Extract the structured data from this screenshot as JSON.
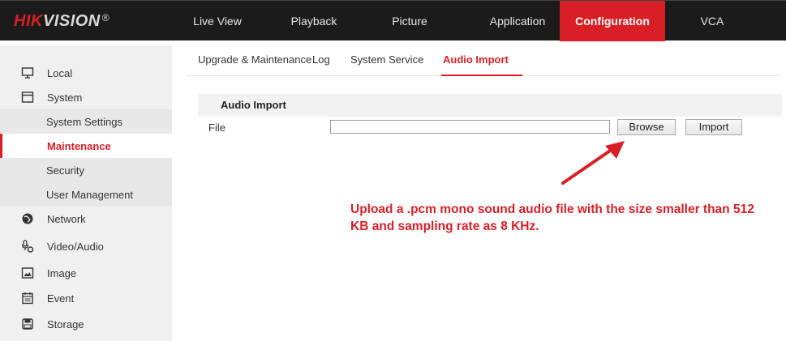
{
  "brand": {
    "prefix": "HIK",
    "suffix": "VISION",
    "reg": "®"
  },
  "topnav": {
    "items": [
      {
        "label": "Live View"
      },
      {
        "label": "Playback"
      },
      {
        "label": "Picture"
      },
      {
        "label": "Application"
      },
      {
        "label": "Configuration",
        "active": true
      },
      {
        "label": "VCA"
      }
    ]
  },
  "sidebar": {
    "items": [
      {
        "label": "Local",
        "icon": "monitor-icon"
      },
      {
        "label": "System",
        "icon": "window-icon"
      },
      {
        "label": "System Settings"
      },
      {
        "label": "Maintenance",
        "active": true
      },
      {
        "label": "Security"
      },
      {
        "label": "User Management"
      },
      {
        "label": "Network",
        "icon": "globe-icon"
      },
      {
        "label": "Video/Audio",
        "icon": "mic-icon"
      },
      {
        "label": "Image",
        "icon": "image-icon"
      },
      {
        "label": "Event",
        "icon": "calendar-icon"
      },
      {
        "label": "Storage",
        "icon": "disk-icon"
      }
    ]
  },
  "tabs": [
    {
      "label": "Upgrade & Maintenance"
    },
    {
      "label": "Log"
    },
    {
      "label": "System Service"
    },
    {
      "label": "Audio Import",
      "active": true
    }
  ],
  "section": {
    "title": "Audio Import",
    "file_label": "File",
    "file_value": "",
    "browse_label": "Browse",
    "import_label": "Import"
  },
  "annotation": {
    "text": "Upload a .pcm mono sound audio file with the size smaller than 512 KB and sampling rate as 8 KHz."
  },
  "colors": {
    "accent": "#d81f26",
    "topbar": "#1b1b1b",
    "sidebar": "#f0f0f0"
  }
}
